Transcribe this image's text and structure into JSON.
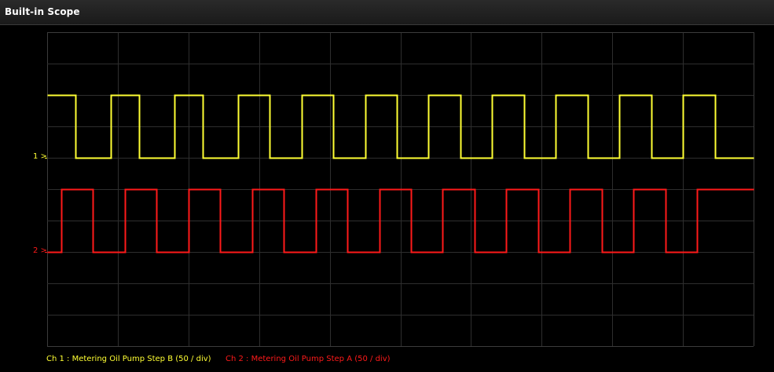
{
  "window": {
    "title": "Built-in Scope"
  },
  "colors": {
    "background": "#000000",
    "grid": "#2e2e2e",
    "grid_border": "#3c3c3c",
    "ch1": "#ffff33",
    "ch2": "#ff1a1a"
  },
  "channels": [
    {
      "marker": "1 >",
      "legend": "Ch 1 : Metering Oil Pump Step B (50 / div)"
    },
    {
      "marker": "2 >",
      "legend": "Ch 2 : Metering Oil Pump Step A (50 / div)"
    }
  ],
  "chart_data": {
    "type": "line",
    "divisions": {
      "x": 10,
      "y": 10
    },
    "grid": true,
    "series": [
      {
        "name": "Ch 1 : Metering Oil Pump Step B (50 / div)",
        "step": true,
        "x": [
          0.0,
          0.4,
          0.4,
          0.9,
          0.9,
          1.3,
          1.3,
          1.8,
          1.8,
          2.2,
          2.2,
          2.7,
          2.7,
          3.15,
          3.15,
          3.6,
          3.6,
          4.05,
          4.05,
          4.5,
          4.5,
          4.95,
          4.95,
          5.4,
          5.4,
          5.85,
          5.85,
          6.3,
          6.3,
          6.75,
          6.75,
          7.2,
          7.2,
          7.65,
          7.65,
          8.1,
          8.1,
          8.55,
          8.55,
          9.0,
          9.0,
          9.45,
          9.45,
          10.0
        ],
        "y": [
          8.0,
          8.0,
          6.0,
          6.0,
          8.0,
          8.0,
          6.0,
          6.0,
          8.0,
          8.0,
          6.0,
          6.0,
          8.0,
          8.0,
          6.0,
          6.0,
          8.0,
          8.0,
          6.0,
          6.0,
          8.0,
          8.0,
          6.0,
          6.0,
          8.0,
          8.0,
          6.0,
          6.0,
          8.0,
          8.0,
          6.0,
          6.0,
          8.0,
          8.0,
          6.0,
          6.0,
          8.0,
          8.0,
          6.0,
          6.0,
          8.0,
          8.0,
          6.0,
          6.0
        ]
      },
      {
        "name": "Ch 2 : Metering Oil Pump Step A (50 / div)",
        "step": true,
        "x": [
          0.0,
          0.2,
          0.2,
          0.65,
          0.65,
          1.1,
          1.1,
          1.55,
          1.55,
          2.0,
          2.0,
          2.45,
          2.45,
          2.9,
          2.9,
          3.35,
          3.35,
          3.8,
          3.8,
          4.25,
          4.25,
          4.7,
          4.7,
          5.15,
          5.15,
          5.6,
          5.6,
          6.05,
          6.05,
          6.5,
          6.5,
          6.95,
          6.95,
          7.4,
          7.4,
          7.85,
          7.85,
          8.3,
          8.3,
          8.75,
          8.75,
          9.2,
          9.2,
          10.0
        ],
        "y": [
          3.0,
          3.0,
          5.0,
          5.0,
          3.0,
          3.0,
          5.0,
          5.0,
          3.0,
          3.0,
          5.0,
          5.0,
          3.0,
          3.0,
          5.0,
          5.0,
          3.0,
          3.0,
          5.0,
          5.0,
          3.0,
          3.0,
          5.0,
          5.0,
          3.0,
          3.0,
          5.0,
          5.0,
          3.0,
          3.0,
          5.0,
          5.0,
          3.0,
          3.0,
          5.0,
          5.0,
          3.0,
          3.0,
          5.0,
          5.0,
          3.0,
          3.0,
          5.0,
          5.0
        ]
      }
    ]
  }
}
